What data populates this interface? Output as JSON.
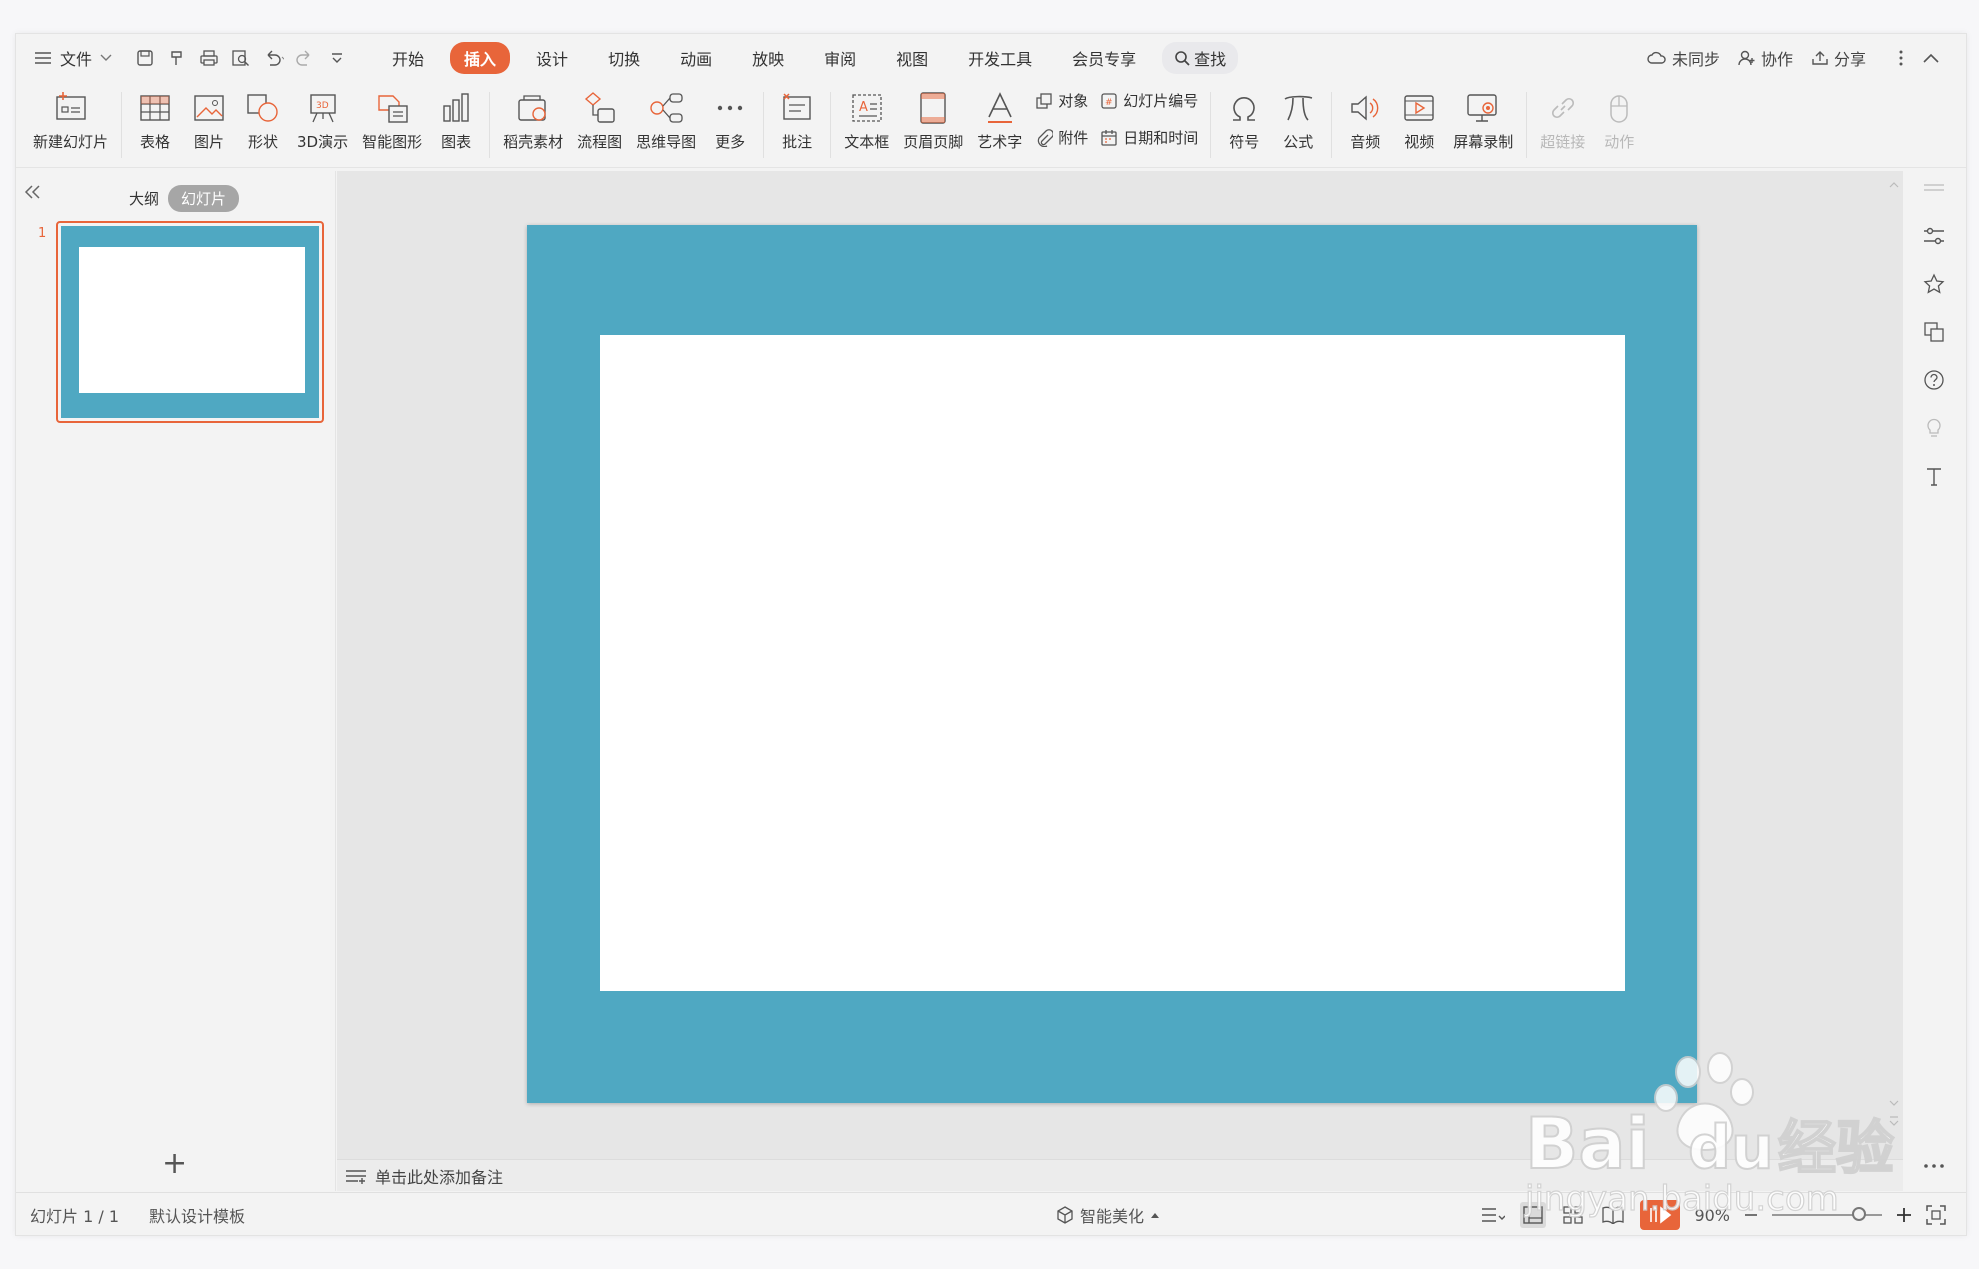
{
  "menu": {
    "file_label": "文件",
    "tabs": [
      "开始",
      "插入",
      "设计",
      "切换",
      "动画",
      "放映",
      "审阅",
      "视图",
      "开发工具",
      "会员专享"
    ],
    "active_tab": "插入",
    "search_label": "查找",
    "right": {
      "sync": "未同步",
      "collab": "协作",
      "share": "分享"
    }
  },
  "ribbon": {
    "new_slide": "新建幻灯片",
    "table": "表格",
    "picture": "图片",
    "shape": "形状",
    "demo3d": "3D演示",
    "smart_shape": "智能图形",
    "chart": "图表",
    "docer": "稻壳素材",
    "flowchart": "流程图",
    "mindmap": "思维导图",
    "more": "更多",
    "comment": "批注",
    "textbox": "文本框",
    "header_footer": "页眉页脚",
    "wordart": "艺术字",
    "object": "对象",
    "attachment": "附件",
    "slide_number": "幻灯片编号",
    "datetime": "日期和时间",
    "symbol": "符号",
    "formula": "公式",
    "audio": "音频",
    "video": "视频",
    "screen_record": "屏幕录制",
    "hyperlink": "超链接",
    "action": "动作"
  },
  "left_panel": {
    "outline_tab": "大纲",
    "slides_tab": "幻灯片",
    "slide_number": "1",
    "add_symbol": "+"
  },
  "notes_placeholder": "单击此处添加备注",
  "status": {
    "slide_counter": "幻灯片 1 / 1",
    "template": "默认设计模板",
    "beautify": "智能美化",
    "zoom": "90%"
  },
  "watermark": {
    "brand": "Bai du 经验",
    "url": "jingyan.baidu.com"
  },
  "colors": {
    "accent": "#e8653a",
    "slide_bg": "#4fa8c2",
    "slide_inner": "#ffffff"
  }
}
